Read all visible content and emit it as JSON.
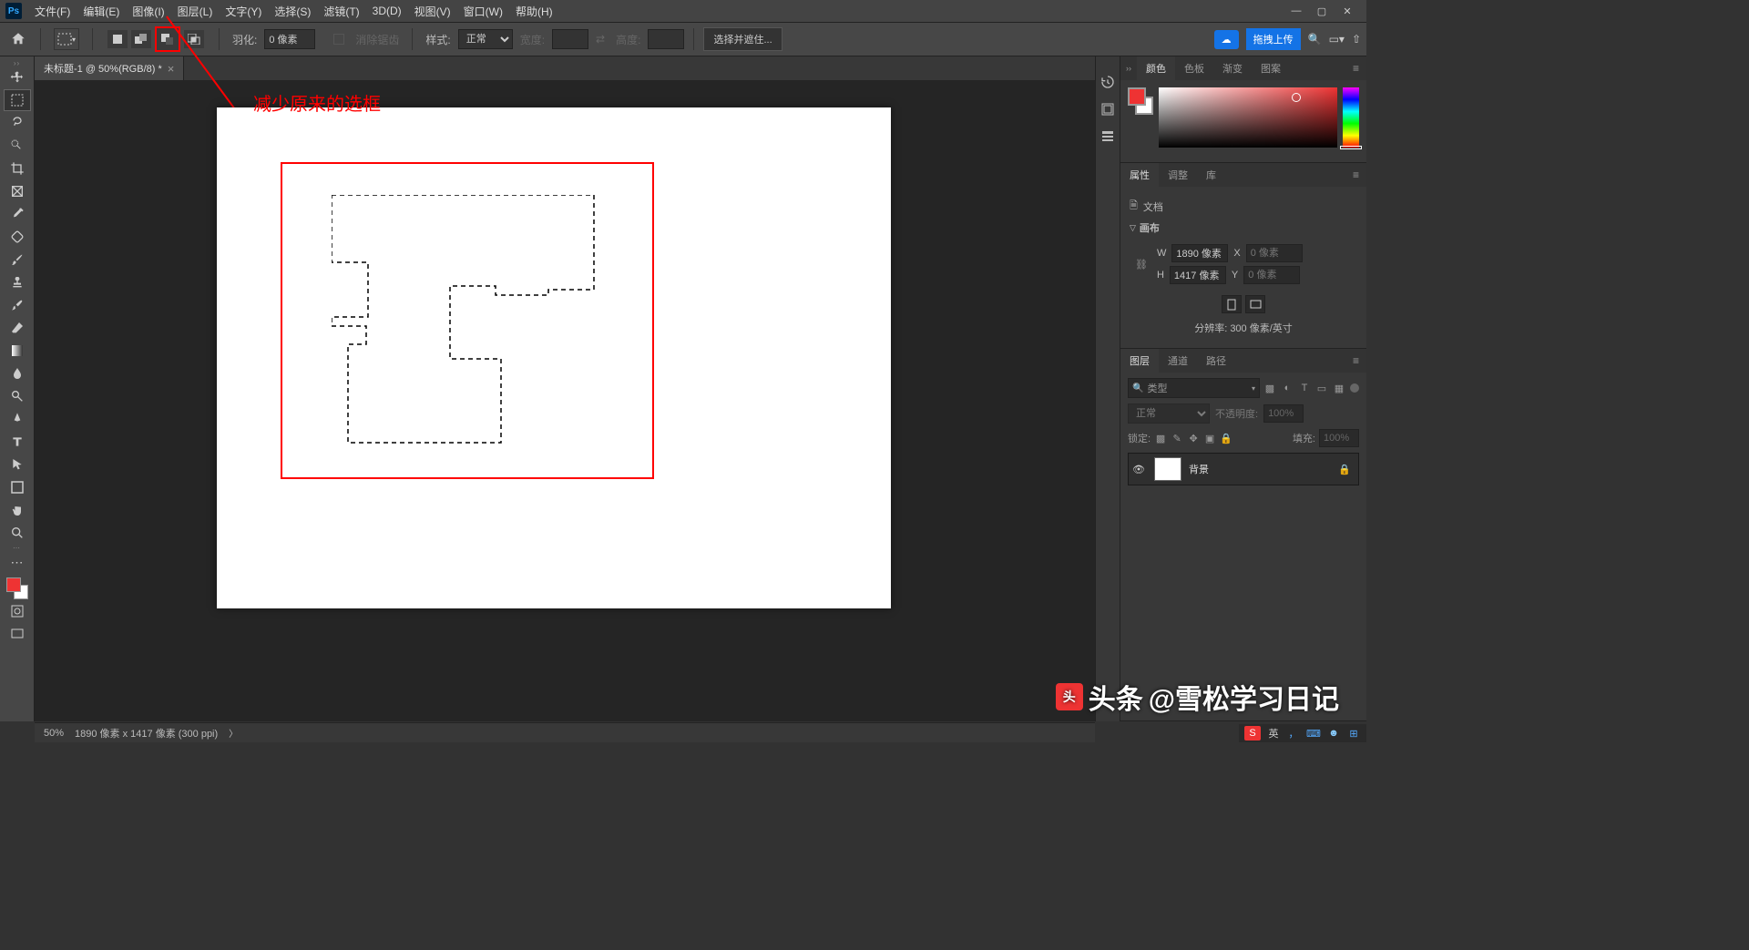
{
  "menubar": {
    "items": [
      "文件(F)",
      "编辑(E)",
      "图像(I)",
      "图层(L)",
      "文字(Y)",
      "选择(S)",
      "滤镜(T)",
      "3D(D)",
      "视图(V)",
      "窗口(W)",
      "帮助(H)"
    ]
  },
  "optbar": {
    "feather_label": "羽化:",
    "feather_value": "0 像素",
    "antialias": "消除锯齿",
    "style_label": "样式:",
    "style_value": "正常",
    "width_label": "宽度:",
    "height_label": "高度:",
    "select_mask": "选择并遮住...",
    "upload_label": "拖拽上传"
  },
  "doc": {
    "tab_title": "未标题-1 @ 50%(RGB/8) *",
    "annotation": "减少原来的选框"
  },
  "panels": {
    "color": {
      "tabs": [
        "颜色",
        "色板",
        "渐变",
        "图案"
      ]
    },
    "props": {
      "tabs": [
        "属性",
        "调整",
        "库"
      ],
      "doc_label": "文档",
      "canvas_label": "画布",
      "w_label": "W",
      "w_value": "1890 像素",
      "x_label": "X",
      "x_value": "0 像素",
      "h_label": "H",
      "h_value": "1417 像素",
      "y_label": "Y",
      "y_value": "0 像素",
      "resolution": "分辨率: 300 像素/英寸"
    },
    "layers": {
      "tabs": [
        "图层",
        "通道",
        "路径"
      ],
      "filter_label": "类型",
      "blend_mode": "正常",
      "opacity_label": "不透明度:",
      "opacity_value": "100%",
      "lock_label": "锁定:",
      "fill_label": "填充:",
      "fill_value": "100%",
      "layer_name": "背景"
    }
  },
  "statusbar": {
    "zoom": "50%",
    "info": "1890 像素 x 1417 像素 (300 ppi)"
  },
  "watermark": {
    "prefix": "头条",
    "text": "@雪松学习日记"
  },
  "taskbar": {
    "ime": "英"
  }
}
